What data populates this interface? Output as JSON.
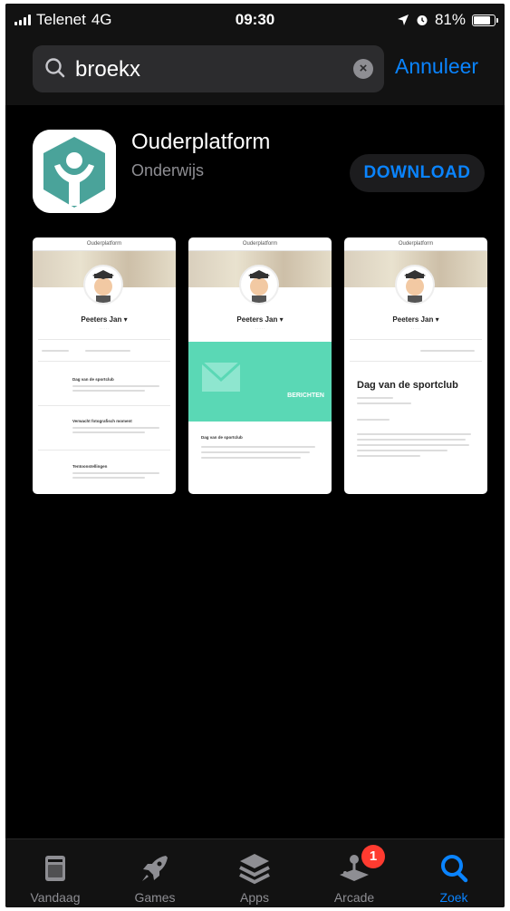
{
  "status_bar": {
    "carrier": "Telenet",
    "network": "4G",
    "time": "09:30",
    "battery": "81%",
    "battery_level": 0.81
  },
  "search": {
    "query": "broekx",
    "cancel_label": "Annuleer"
  },
  "app": {
    "name": "Ouderplatform",
    "category": "Onderwijs",
    "button_label": "DOWNLOAD",
    "colors": {
      "icon_bg": "#4aa39a",
      "accent": "#0a84ff"
    }
  },
  "screenshots": [
    {
      "header": "Ouderplatform",
      "name": "Peeters Jan ▾",
      "list_items": [
        "Dag van de sportclub",
        "Verwacht fotografisch moment",
        "Tentoonstellingen"
      ]
    },
    {
      "header": "Ouderplatform",
      "name": "Peeters Jan ▾",
      "banner_label": "BERICHTEN",
      "list_items": [
        "Dag van de sportclub"
      ]
    },
    {
      "header": "Ouderplatform",
      "name": "Peeters Jan ▾",
      "title": "Dag van de sportclub"
    }
  ],
  "tabbar": {
    "tabs": [
      {
        "label": "Vandaag",
        "icon": "today-icon"
      },
      {
        "label": "Games",
        "icon": "rocket-icon"
      },
      {
        "label": "Apps",
        "icon": "apps-stack-icon"
      },
      {
        "label": "Arcade",
        "icon": "joystick-icon",
        "badge": "1"
      },
      {
        "label": "Zoek",
        "icon": "search-icon",
        "active": true
      }
    ]
  }
}
